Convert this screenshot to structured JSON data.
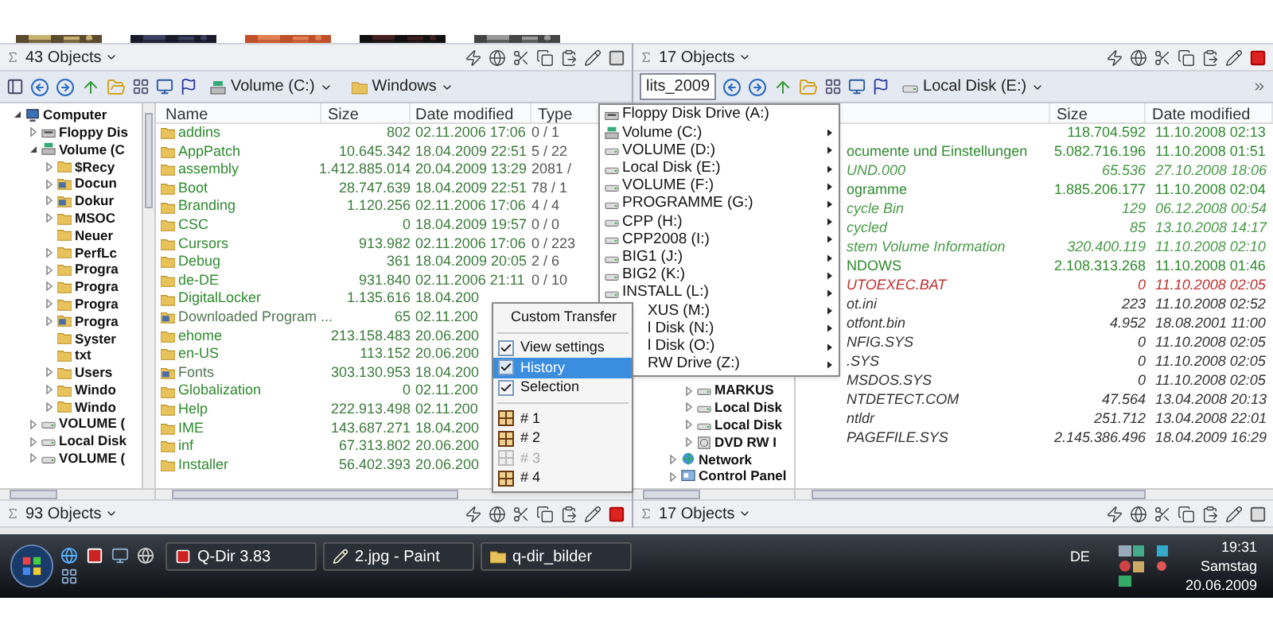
{
  "left_pane": {
    "status_top": {
      "label": "43 Objects",
      "active": false
    },
    "toolbar": {
      "drive": "Volume (C:)",
      "folder": "Windows"
    },
    "tree": [
      {
        "label": "Computer",
        "kind": "computer",
        "expanded": true,
        "children": [
          {
            "label": "Floppy Dis",
            "kind": "floppy",
            "expanded": false
          },
          {
            "label": "Volume (C",
            "kind": "system-drive",
            "expanded": true,
            "children": [
              {
                "label": "$Recy",
                "kind": "folder",
                "expanded": false
              },
              {
                "label": "Docun",
                "kind": "special",
                "expanded": false
              },
              {
                "label": "Dokur",
                "kind": "special",
                "expanded": false
              },
              {
                "label": "MSOC",
                "kind": "folder",
                "expanded": false
              },
              {
                "label": "Neuer",
                "kind": "folder"
              },
              {
                "label": "PerfLc",
                "kind": "folder",
                "expanded": false
              },
              {
                "label": "Progra",
                "kind": "folder",
                "expanded": false
              },
              {
                "label": "Progra",
                "kind": "folder",
                "expanded": false
              },
              {
                "label": "Progra",
                "kind": "folder",
                "expanded": false
              },
              {
                "label": "Progra",
                "kind": "special",
                "expanded": false
              },
              {
                "label": "Syster",
                "kind": "folder"
              },
              {
                "label": "txt",
                "kind": "folder"
              },
              {
                "label": "Users",
                "kind": "folder",
                "expanded": false
              },
              {
                "label": "Windo",
                "kind": "folder",
                "expanded": false
              },
              {
                "label": "Windo",
                "kind": "folder",
                "expanded": false
              }
            ]
          },
          {
            "label": "VOLUME (",
            "kind": "drive",
            "expanded": false
          },
          {
            "label": "Local Disk",
            "kind": "drive",
            "expanded": false
          },
          {
            "label": "VOLUME (",
            "kind": "drive",
            "expanded": false
          }
        ]
      }
    ],
    "columns": [
      "Name",
      "Size",
      "Date modified",
      "Type"
    ],
    "rows": [
      {
        "name": "addins",
        "size": "802",
        "date": "02.11.2006 17:06",
        "type": "0 / 1",
        "kind": "folder"
      },
      {
        "name": "AppPatch",
        "size": "10.645.342",
        "date": "18.04.2009 22:51",
        "type": "5 / 22",
        "kind": "folder"
      },
      {
        "name": "assembly",
        "size": "1.412.885.014",
        "date": "20.04.2009 13:29",
        "type": "2081 /",
        "kind": "folder"
      },
      {
        "name": "Boot",
        "size": "28.747.639",
        "date": "18.04.2009 22:51",
        "type": "78 / 1",
        "kind": "folder"
      },
      {
        "name": "Branding",
        "size": "1.120.256",
        "date": "02.11.2006 17:06",
        "type": "4 / 4",
        "kind": "folder"
      },
      {
        "name": "CSC",
        "size": "0",
        "date": "18.04.2009 19:57",
        "type": "0 / 0",
        "kind": "folder"
      },
      {
        "name": "Cursors",
        "size": "913.982",
        "date": "02.11.2006 17:06",
        "type": "0 / 223",
        "kind": "folder"
      },
      {
        "name": "Debug",
        "size": "361",
        "date": "18.04.2009 20:05",
        "type": "2 / 6",
        "kind": "folder"
      },
      {
        "name": "de-DE",
        "size": "931.840",
        "date": "02.11.2006 21:11",
        "type": "0 / 10",
        "kind": "folder"
      },
      {
        "name": "DigitalLocker",
        "size": "1.135.616",
        "date": "18.04.200",
        "kind": "folder"
      },
      {
        "name": "Downloaded Program ...",
        "size": "65",
        "date": "02.11.200",
        "kind": "special"
      },
      {
        "name": "ehome",
        "size": "213.158.483",
        "date": "20.06.200",
        "kind": "folder"
      },
      {
        "name": "en-US",
        "size": "113.152",
        "date": "20.06.200",
        "kind": "folder"
      },
      {
        "name": "Fonts",
        "size": "303.130.953",
        "date": "18.04.200",
        "kind": "special"
      },
      {
        "name": "Globalization",
        "size": "0",
        "date": "02.11.200",
        "kind": "folder"
      },
      {
        "name": "Help",
        "size": "222.913.498",
        "date": "02.11.200",
        "kind": "folder"
      },
      {
        "name": "IME",
        "size": "143.687.271",
        "date": "18.04.200",
        "kind": "folder"
      },
      {
        "name": "inf",
        "size": "67.313.802",
        "date": "20.06.200",
        "kind": "folder"
      },
      {
        "name": "Installer",
        "size": "56.402.393",
        "date": "20.06.200",
        "kind": "folder"
      }
    ],
    "status_bottom": {
      "label": "93 Objects",
      "active": true
    }
  },
  "right_pane": {
    "status_top": {
      "label": "17 Objects",
      "active": true
    },
    "toolbar": {
      "tab": "lits_2009",
      "drive": "Local Disk (E:)"
    },
    "tree": [
      {
        "children": [
          {
            "label": "MARKUS",
            "kind": "drive",
            "expanded": false
          },
          {
            "label": "Local Disk",
            "kind": "drive",
            "expanded": false
          },
          {
            "label": "Local Disk",
            "kind": "drive",
            "expanded": false
          },
          {
            "label": "DVD RW I",
            "kind": "dvd",
            "expanded": false
          }
        ]
      },
      {
        "label": "Network",
        "kind": "network",
        "expanded": false
      },
      {
        "label": "Control Panel",
        "kind": "control",
        "expanded": false
      }
    ],
    "columns": [
      "Size",
      "Date modified"
    ],
    "rows": [
      {
        "size": "118.704.592",
        "date": "11.10.2008 02:13",
        "kind": "folder"
      },
      {
        "name": "ocumente und Einstellungen",
        "size": "5.082.716.196",
        "date": "11.10.2008 01:51",
        "kind": "folder"
      },
      {
        "name": "UND.000",
        "size": "65.536",
        "date": "27.10.2008 18:06",
        "kind": "hidden-folder"
      },
      {
        "name": "ogramme",
        "size": "1.885.206.177",
        "date": "11.10.2008 02:04",
        "kind": "folder"
      },
      {
        "name": "cycle Bin",
        "size": "129",
        "date": "06.12.2008 00:54",
        "kind": "hidden-folder"
      },
      {
        "name": "cycled",
        "size": "85",
        "date": "13.10.2008 14:17",
        "kind": "hidden-folder"
      },
      {
        "name": "stem Volume Information",
        "size": "320.400.119",
        "date": "11.10.2008 02:10",
        "kind": "hidden-folder"
      },
      {
        "name": "NDOWS",
        "size": "2.108.313.268",
        "date": "11.10.2008 01:46",
        "kind": "folder"
      },
      {
        "name": "UTOEXEC.BAT",
        "size": "0",
        "date": "11.10.2008 02:05",
        "kind": "recent-file"
      },
      {
        "name": "ot.ini",
        "size": "223",
        "date": "11.10.2008 02:52",
        "kind": "hidden-file"
      },
      {
        "name": "otfont.bin",
        "size": "4.952",
        "date": "18.08.2001 11:00",
        "kind": "hidden-file"
      },
      {
        "name": "NFIG.SYS",
        "size": "0",
        "date": "11.10.2008 02:05",
        "kind": "hidden-file"
      },
      {
        "name": ".SYS",
        "size": "0",
        "date": "11.10.2008 02:05",
        "kind": "hidden-file"
      },
      {
        "name": "MSDOS.SYS",
        "size": "0",
        "date": "11.10.2008 02:05",
        "kind": "hidden-file"
      },
      {
        "name": "NTDETECT.COM",
        "size": "47.564",
        "date": "13.04.2008 20:13",
        "kind": "hidden-file"
      },
      {
        "name": "ntldr",
        "size": "251.712",
        "date": "13.04.2008 22:01",
        "kind": "hidden-file"
      },
      {
        "name": "PAGEFILE.SYS",
        "size": "2.145.386.496",
        "date": "18.04.2009 16:29",
        "kind": "hidden-file"
      }
    ],
    "status_bottom": {
      "label": "17 Objects",
      "active": false
    }
  },
  "drive_menu": [
    {
      "label": "Floppy Disk Drive (A:)",
      "kind": "floppy",
      "submenu": false
    },
    {
      "label": "Volume (C:)",
      "kind": "system-drive",
      "submenu": true
    },
    {
      "label": "VOLUME (D:)",
      "kind": "drive",
      "submenu": true
    },
    {
      "label": "Local Disk (E:)",
      "kind": "drive",
      "submenu": true
    },
    {
      "label": "VOLUME (F:)",
      "kind": "drive",
      "submenu": true
    },
    {
      "label": "PROGRAMME (G:)",
      "kind": "drive",
      "submenu": true
    },
    {
      "label": "CPP (H:)",
      "kind": "drive",
      "submenu": true
    },
    {
      "label": "CPP2008 (I:)",
      "kind": "drive",
      "submenu": true
    },
    {
      "label": "BIG1 (J:)",
      "kind": "drive",
      "submenu": true
    },
    {
      "label": "BIG2 (K:)",
      "kind": "drive",
      "submenu": true
    },
    {
      "label": "INSTALL (L:)",
      "kind": "drive",
      "submenu": true
    },
    {
      "label": "XUS (M:)",
      "kind": "partial",
      "submenu": true
    },
    {
      "label": "l Disk (N:)",
      "kind": "partial",
      "submenu": true
    },
    {
      "label": "l Disk (O:)",
      "kind": "partial",
      "submenu": true
    },
    {
      "label": "RW Drive (Z:)",
      "kind": "partial",
      "submenu": true
    }
  ],
  "context_menu": [
    {
      "label": "Custom Transfer",
      "kind": "command",
      "highlighted": false,
      "disabled": false
    },
    {
      "label": "View settings",
      "kind": "check",
      "checked": true,
      "highlighted": false,
      "disabled": false
    },
    {
      "label": "History",
      "kind": "check",
      "checked": true,
      "highlighted": true,
      "disabled": false
    },
    {
      "label": "Selection",
      "kind": "check",
      "checked": true,
      "highlighted": false,
      "disabled": false
    },
    {
      "label": "# 1",
      "kind": "layout",
      "highlighted": false,
      "disabled": false
    },
    {
      "label": "# 2",
      "kind": "layout",
      "highlighted": false,
      "disabled": false
    },
    {
      "label": "# 3",
      "kind": "layout",
      "highlighted": false,
      "disabled": true
    },
    {
      "label": "# 4",
      "kind": "layout",
      "highlighted": false,
      "disabled": false
    }
  ],
  "taskbar": {
    "tasks": [
      {
        "label": "Q-Dir 3.83",
        "kind": "app"
      },
      {
        "label": "2.jpg - Paint",
        "kind": "paint"
      },
      {
        "label": "q-dir_bilder",
        "kind": "folder"
      }
    ],
    "language": "DE",
    "clock": {
      "time": "19:31",
      "day": "Samstag",
      "date": "20.06.2009"
    }
  }
}
